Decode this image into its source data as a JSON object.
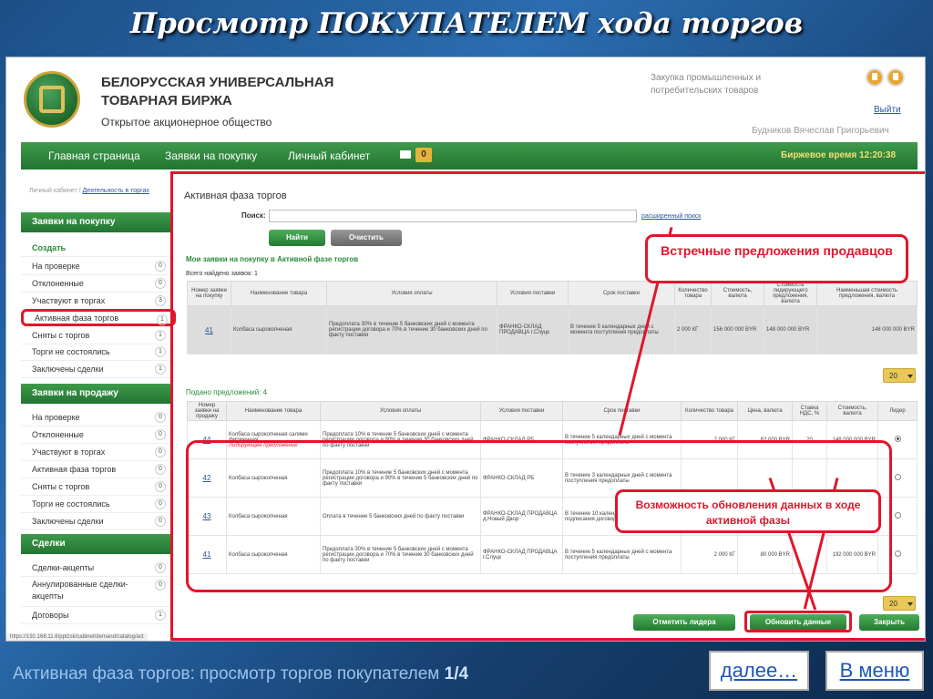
{
  "slide": {
    "title": "Просмотр ПОКУПАТЕЛЕМ хода торгов",
    "caption": "Активная фаза торгов: просмотр торгов покупателем",
    "page": "1/4",
    "next": "далее…",
    "menu": "В меню"
  },
  "header": {
    "org_line1": "БЕЛОРУССКАЯ УНИВЕРСАЛЬНАЯ",
    "org_line2": "ТОВАРНАЯ БИРЖА",
    "org_line3": "Открытое акционерное общество",
    "purchase_info": "Закупка промышленных и потребительских товаров",
    "exit": "Выйти",
    "user": "Будников Вячеслав Григорьевич"
  },
  "nav": {
    "items": [
      "Главная страница",
      "Заявки на покупку",
      "Личный кабинет"
    ],
    "mail_count": "0",
    "exchange_time": "Биржевое время 12:20:38"
  },
  "breadcrumb": {
    "home": "Личный кабинет / ",
    "current": "Деятельность в торгах"
  },
  "sidebar": {
    "buy_head": "Заявки на покупку",
    "create": "Создать",
    "buy_items": [
      {
        "label": "На проверке",
        "count": "0"
      },
      {
        "label": "Отклоненные",
        "count": "0"
      },
      {
        "label": "Участвуют в торгах",
        "count": "3"
      },
      {
        "label": "Активная фаза торгов",
        "count": "1"
      },
      {
        "label": "Сняты с торгов",
        "count": "1"
      },
      {
        "label": "Торги не состоялись",
        "count": "1"
      },
      {
        "label": "Заключены сделки",
        "count": "1"
      }
    ],
    "sell_head": "Заявки на продажу",
    "sell_items": [
      {
        "label": "На проверке",
        "count": "0"
      },
      {
        "label": "Отклоненные",
        "count": "0"
      },
      {
        "label": "Участвуют в торгах",
        "count": "0"
      },
      {
        "label": "Активная фаза торгов",
        "count": "0"
      },
      {
        "label": "Сняты с торгов",
        "count": "0"
      },
      {
        "label": "Торги не состоялись",
        "count": "0"
      },
      {
        "label": "Заключены сделки",
        "count": "0"
      }
    ],
    "deals_head": "Сделки",
    "deal_items": [
      {
        "label": "Сделки-акцепты",
        "count": "0"
      },
      {
        "label": "Аннулированные сделки-акцепты",
        "count": "0"
      },
      {
        "label": "Договоры",
        "count": "1"
      }
    ]
  },
  "main": {
    "title": "Активная фаза торгов",
    "search_label": "Поиск:",
    "search_value": "",
    "adv_search": "расширенный поиск",
    "find_btn": "Найти",
    "clear_btn": "Очистить",
    "my_bids_title": "Мои заявки на покупку в Активной фазе торгов",
    "found": "Всего найдено заявок: 1",
    "bids_headers": [
      "Номер заявки на покупку",
      "Наименование товара",
      "Условия оплаты",
      "Условия поставки",
      "Срок поставки",
      "Количество товара",
      "Стоимость, валюта",
      "Стоимость лидирующего предложения, валюта",
      "Наименьшая стоимость предложения, валюта"
    ],
    "bid_row": {
      "num": "41",
      "name": "Колбаса сырокопченая",
      "payment": "Предоплата 30% в течение 5 банковских дней с момента регистрации договора и 70% в течение 30 банковских дней по факту поставки",
      "delivery": "ФРАНКО-СКЛАД ПРОДАВЦА г.Слуцк",
      "term": "В течение 5 календарных дней с момента поступления предоплаты",
      "qty": "2 000 КГ",
      "cost": "156 000 000 BYR",
      "leader_cost": "148 000 000 BYR",
      "min_cost": "148 000 000 BYR"
    },
    "pager_value": "20",
    "offers_title": "Подано предложений: 4",
    "offers_headers": [
      "Номер заявки на продажу",
      "Наименование товара",
      "Условия оплаты",
      "Условия поставки",
      "Срок поставки",
      "Количество товара",
      "Цена, валюта",
      "Ставка НДС, %",
      "Стоимость, валюта",
      "Лидер"
    ],
    "offers": [
      {
        "num": "44",
        "name": "Колбаса сырокопченая салями фирменная",
        "tag": "Лидирующее предложение",
        "payment": "Предоплата 10% в течение 5 банковских дней с момента регистрации договора и 90% в течение 30 банковских дней по факту поставки",
        "delivery": "ФРАНКО-СКЛАД РБ",
        "term": "В течение 5 календарных дней с момента поступления предоплаты",
        "qty": "2 000 КГ",
        "price": "62 000 BYR",
        "vat": "20",
        "cost": "148 000 000 BYR",
        "leader": true
      },
      {
        "num": "42",
        "name": "Колбаса сырокопченая",
        "tag": "",
        "payment": "Предоплата 10% в течение 5 банковских дней с момента регистрации договора и 90% в течение 5 банковских дней по факту поставки",
        "delivery": "ФРАНКО-СКЛАД РБ",
        "term": "В течение 3 календарных дней с момента поступления предоплаты",
        "qty": "",
        "price": "",
        "vat": "",
        "cost": "",
        "leader": false
      },
      {
        "num": "43",
        "name": "Колбаса сырокопченая",
        "tag": "",
        "payment": "Оплата в течение 5 банковских дней по факту поставки",
        "delivery": "ФРАНКО-СКЛАД ПРОДАВЦА д.Новый Двор",
        "term": "В течение 10 календарных дней с момента подписания договора биржи",
        "qty": "",
        "price": "",
        "vat": "",
        "cost": "",
        "leader": false
      },
      {
        "num": "41",
        "name": "Колбаса сырокопченая",
        "tag": "",
        "payment": "Предоплата 30% в течение 5 банковских дней с момента регистрации договора и 70% в течение 30 банковских дней по факту поставки",
        "delivery": "ФРАНКО-СКЛАД ПРОДАВЦА г.Слуцк",
        "term": "В течение 5 календарных дней с момента поступления предоплаты",
        "qty": "2 000 КГ",
        "price": "80 000 BYR",
        "vat": "",
        "cost": "192 000 000 BYR",
        "leader": false
      }
    ],
    "mark_leader_btn": "Отметить лидера",
    "update_btn": "Обновить данные",
    "close_btn": "Закрыть"
  },
  "annotations": {
    "counter_offers": "Встречные предложения продавцов",
    "update_hint": "Возможность обновления данных в ходе активной фазы"
  },
  "status_url": "https://192.168.11.6/pptzsk/cabinet/demand/catalog/act",
  "colors": {
    "accent_green": "#227432",
    "highlight_red": "#e0162b",
    "link_blue": "#2a55a0"
  }
}
